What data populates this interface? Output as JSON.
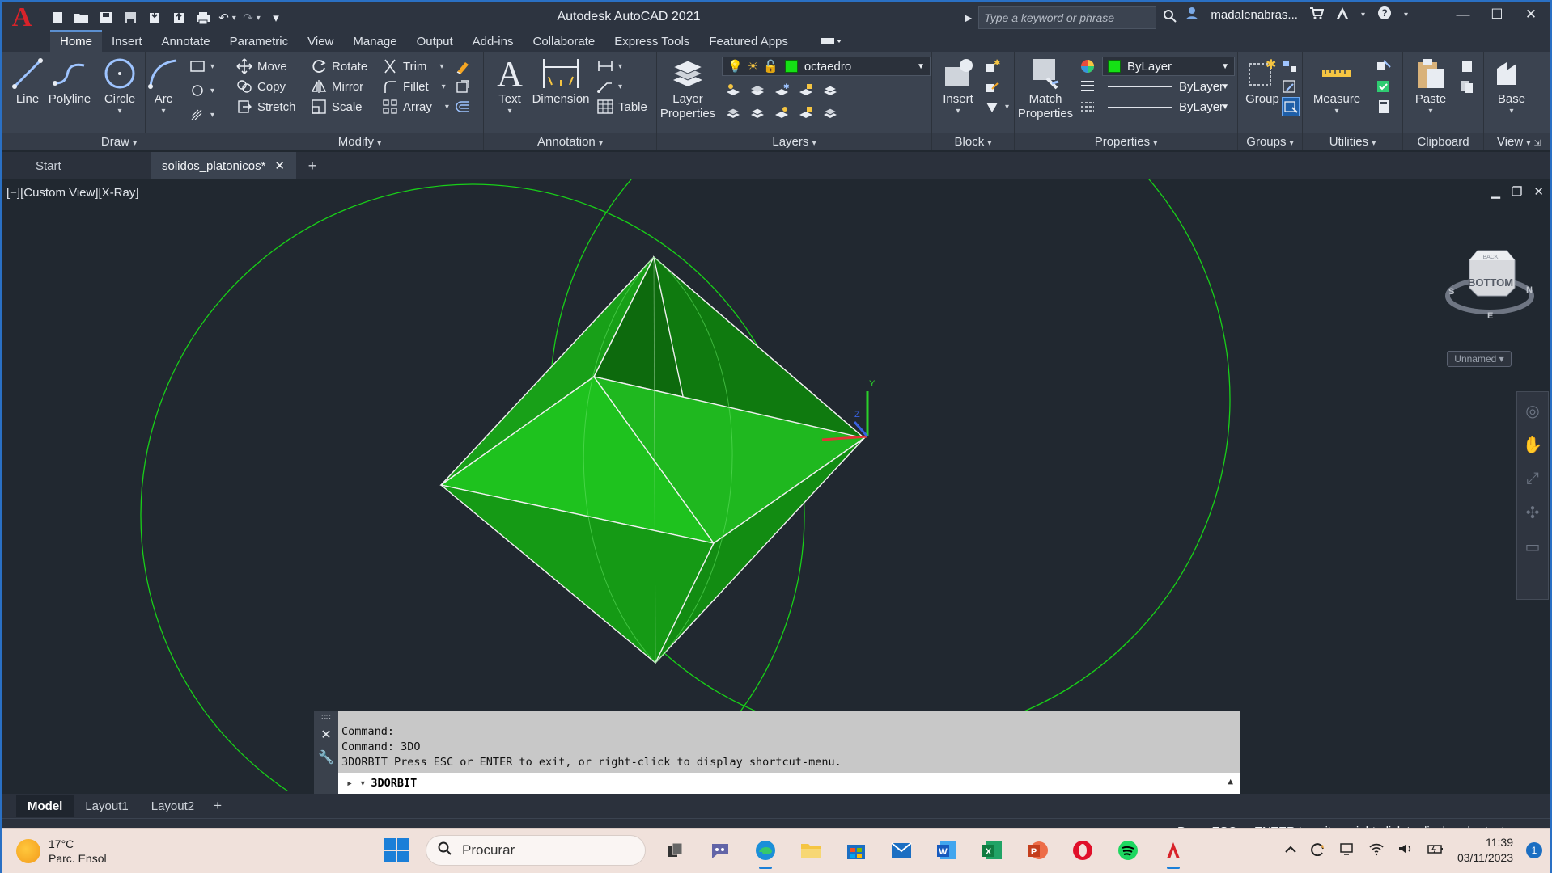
{
  "window": {
    "title": "Autodesk AutoCAD 2021",
    "app_logo": "A",
    "search_placeholder": "Type a keyword or phrase",
    "user": "madalenabras...",
    "min": "—",
    "max": "☐",
    "close": "✕"
  },
  "ribbon_tabs": [
    "Home",
    "Insert",
    "Annotate",
    "Parametric",
    "View",
    "Manage",
    "Output",
    "Add-ins",
    "Collaborate",
    "Express Tools",
    "Featured Apps"
  ],
  "draw": {
    "title": "Draw",
    "line": "Line",
    "polyline": "Polyline",
    "circle": "Circle",
    "arc": "Arc"
  },
  "modify": {
    "title": "Modify",
    "move": "Move",
    "rotate": "Rotate",
    "trim": "Trim",
    "copy": "Copy",
    "mirror": "Mirror",
    "fillet": "Fillet",
    "stretch": "Stretch",
    "scale": "Scale",
    "array": "Array"
  },
  "annotation": {
    "title": "Annotation",
    "text": "Text",
    "dimension": "Dimension",
    "table": "Table"
  },
  "layers": {
    "title": "Layers",
    "layer_properties": "Layer Properties",
    "current_layer": "octaedro",
    "layer_color": "#15e015"
  },
  "block": {
    "title": "Block",
    "insert": "Insert"
  },
  "properties": {
    "title": "Properties",
    "match": "Match Properties",
    "color": "ByLayer",
    "lineweight": "ByLayer",
    "linetype": "ByLayer"
  },
  "groups": {
    "title": "Groups",
    "group": "Group"
  },
  "utilities": {
    "title": "Utilities",
    "measure": "Measure"
  },
  "clipboard": {
    "title": "Clipboard",
    "paste": "Paste"
  },
  "view_panel": {
    "title": "View",
    "base": "Base"
  },
  "doc_tabs": {
    "start": "Start",
    "active": "solidos_platonicos*",
    "close": "✕",
    "plus": "+"
  },
  "viewport": {
    "label": "[−][Custom View][X-Ray]",
    "viewcube_face": "BOTTOM",
    "viewcube_top": "BACK",
    "compass_w": "S",
    "compass_e": "N",
    "compass_s": "E",
    "named_view": "Unnamed",
    "ucs_y": "Y",
    "ucs_z": "Z",
    "solid_color": "#1aa51a"
  },
  "command": {
    "history": [
      "Command:",
      "Command: 3DO",
      "3DORBIT Press ESC or ENTER to exit, or right-click to display shortcut-menu."
    ],
    "input": "3DORBIT"
  },
  "layout_tabs": [
    "Model",
    "Layout1",
    "Layout2"
  ],
  "status_text": "Press ESC or ENTER to exit, or right-click to display shortcut-menu.",
  "taskbar": {
    "temperature": "17°C",
    "weather_desc": "Parc. Ensol",
    "search": "Procurar",
    "time": "11:39",
    "date": "03/11/2023",
    "notifications": "1"
  }
}
